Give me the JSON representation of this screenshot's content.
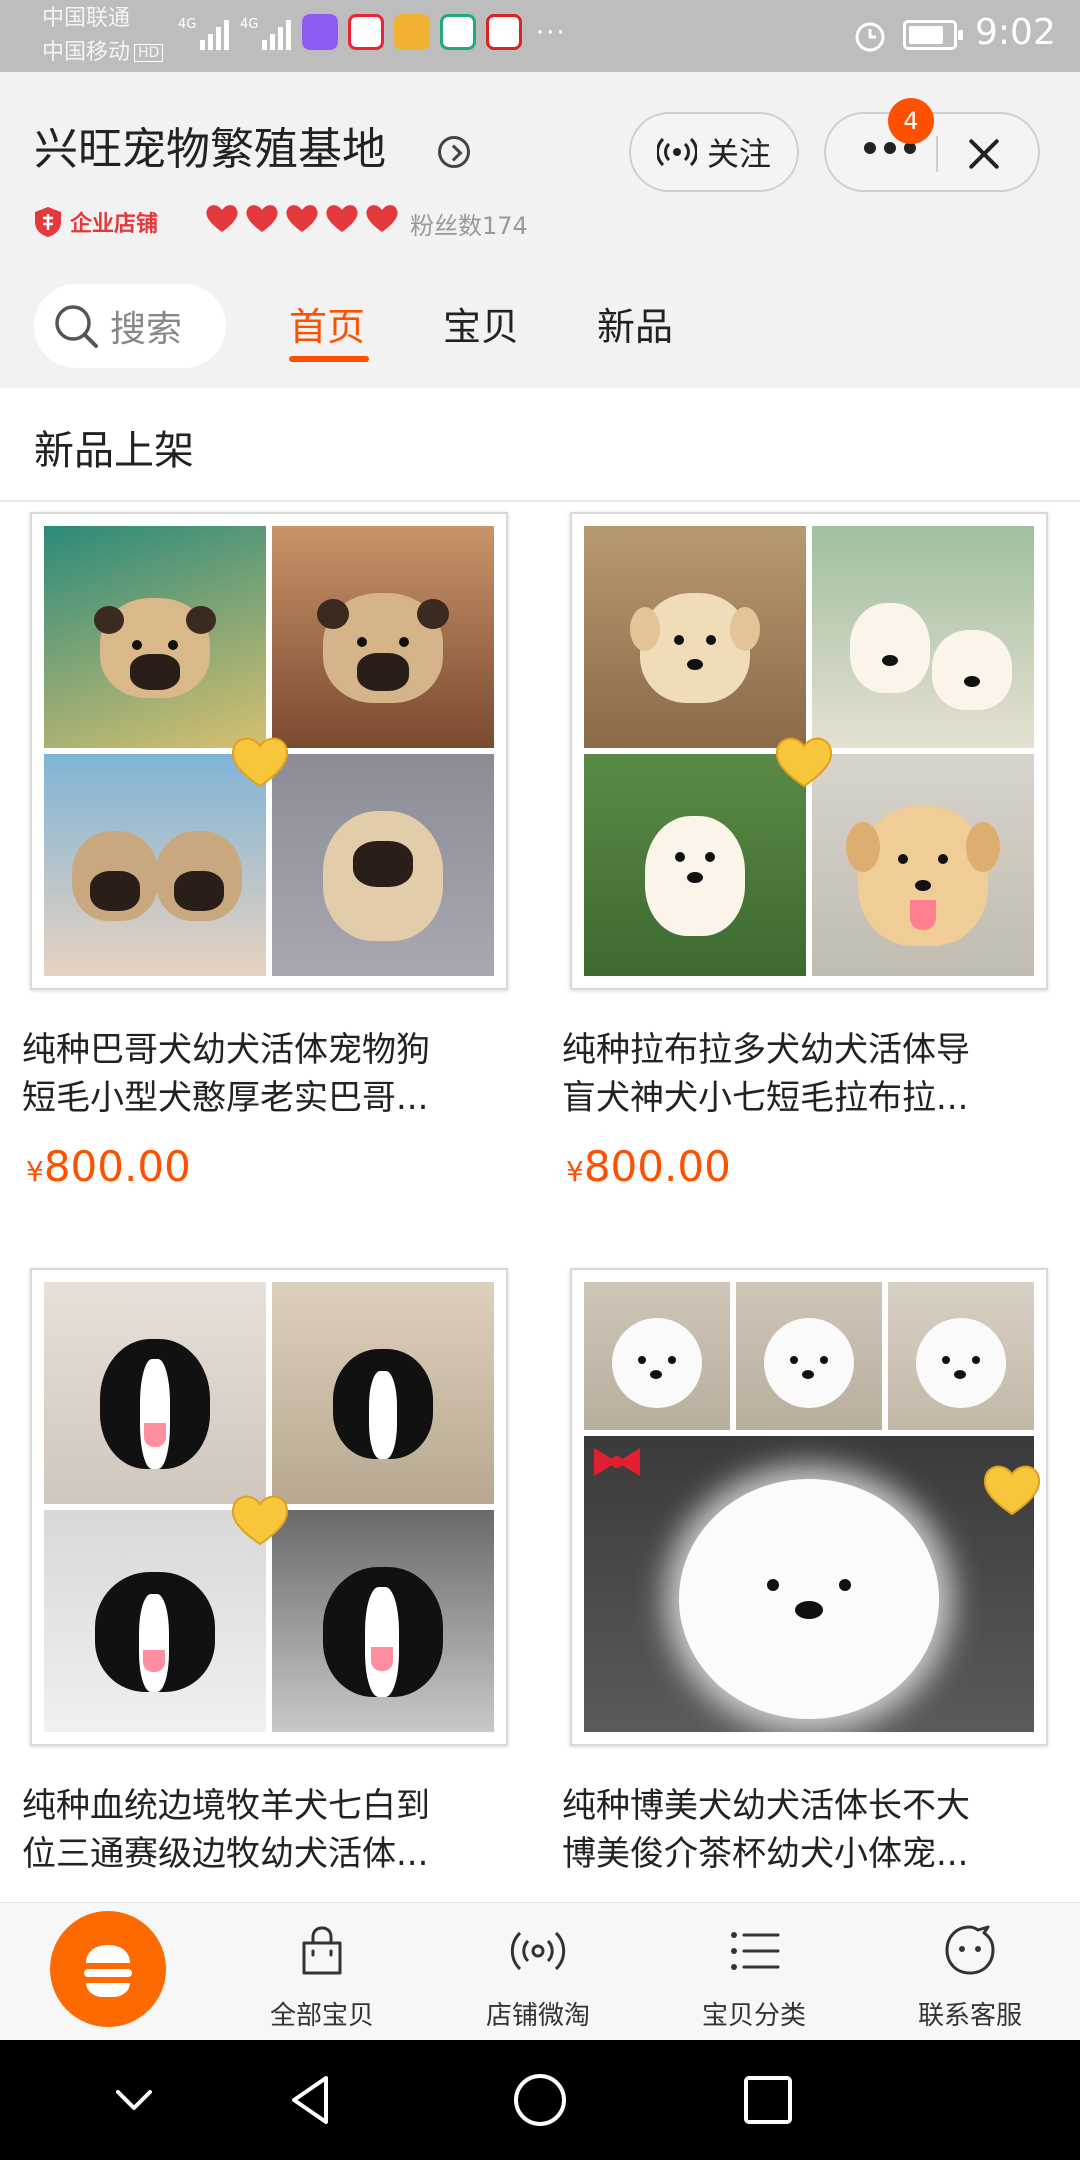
{
  "status_bar": {
    "carrier1": "中国联通",
    "carrier2": "中国移动",
    "hd_badge": "HD",
    "signal1_label": "4G",
    "signal2_label": "4G",
    "more_dots": "···",
    "time": "9:02",
    "battery_level": 0.8
  },
  "header": {
    "shop_name": "兴旺宠物繁殖基地",
    "follow_label": "关注",
    "notification_count": "4",
    "shop_type": "企业店铺",
    "rating_hearts": 5,
    "fans": "粉丝数174"
  },
  "nav": {
    "search_placeholder": "搜索",
    "tabs": [
      {
        "label": "首页",
        "active": true
      },
      {
        "label": "宝贝",
        "active": false
      },
      {
        "label": "新品",
        "active": false
      }
    ]
  },
  "section": {
    "title": "新品上架"
  },
  "products": [
    {
      "title_line1": "纯种巴哥犬幼犬活体宠物狗",
      "title_line2": "短毛小型犬憨厚老实巴哥...",
      "currency": "¥",
      "price": "800.00"
    },
    {
      "title_line1": "纯种拉布拉多犬幼犬活体导",
      "title_line2": "盲犬神犬小七短毛拉布拉...",
      "currency": "¥",
      "price": "800.00"
    },
    {
      "title_line1": "纯种血统边境牧羊犬七白到",
      "title_line2": "位三通赛级边牧幼犬活体..."
    },
    {
      "title_line1": "纯种博美犬幼犬活体长不大",
      "title_line2": "博美俊介茶杯幼犬小体宠..."
    }
  ],
  "bottom_tabs": [
    {
      "label": "全部宝贝",
      "icon": "bag-icon"
    },
    {
      "label": "店铺微淘",
      "icon": "broadcast-icon"
    },
    {
      "label": "宝贝分类",
      "icon": "list-icon"
    },
    {
      "label": "联系客服",
      "icon": "chat-face-icon"
    }
  ],
  "colors": {
    "accent": "#ff5000",
    "heart": "#e4393c",
    "status_bar": "#bdbdbd"
  }
}
